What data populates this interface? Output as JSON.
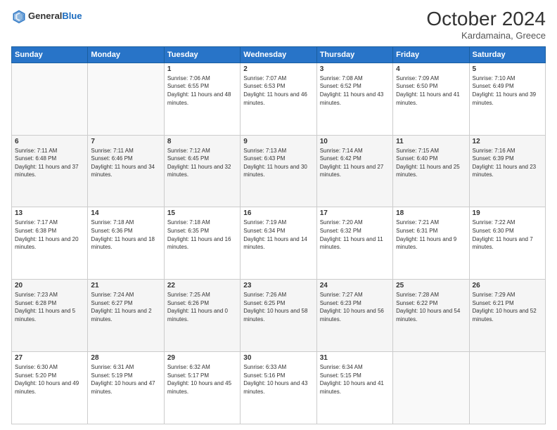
{
  "header": {
    "logo_general": "General",
    "logo_blue": "Blue",
    "month": "October 2024",
    "location": "Kardamaina, Greece"
  },
  "weekdays": [
    "Sunday",
    "Monday",
    "Tuesday",
    "Wednesday",
    "Thursday",
    "Friday",
    "Saturday"
  ],
  "weeks": [
    [
      {
        "day": "",
        "sunrise": "",
        "sunset": "",
        "daylight": ""
      },
      {
        "day": "",
        "sunrise": "",
        "sunset": "",
        "daylight": ""
      },
      {
        "day": "1",
        "sunrise": "Sunrise: 7:06 AM",
        "sunset": "Sunset: 6:55 PM",
        "daylight": "Daylight: 11 hours and 48 minutes."
      },
      {
        "day": "2",
        "sunrise": "Sunrise: 7:07 AM",
        "sunset": "Sunset: 6:53 PM",
        "daylight": "Daylight: 11 hours and 46 minutes."
      },
      {
        "day": "3",
        "sunrise": "Sunrise: 7:08 AM",
        "sunset": "Sunset: 6:52 PM",
        "daylight": "Daylight: 11 hours and 43 minutes."
      },
      {
        "day": "4",
        "sunrise": "Sunrise: 7:09 AM",
        "sunset": "Sunset: 6:50 PM",
        "daylight": "Daylight: 11 hours and 41 minutes."
      },
      {
        "day": "5",
        "sunrise": "Sunrise: 7:10 AM",
        "sunset": "Sunset: 6:49 PM",
        "daylight": "Daylight: 11 hours and 39 minutes."
      }
    ],
    [
      {
        "day": "6",
        "sunrise": "Sunrise: 7:11 AM",
        "sunset": "Sunset: 6:48 PM",
        "daylight": "Daylight: 11 hours and 37 minutes."
      },
      {
        "day": "7",
        "sunrise": "Sunrise: 7:11 AM",
        "sunset": "Sunset: 6:46 PM",
        "daylight": "Daylight: 11 hours and 34 minutes."
      },
      {
        "day": "8",
        "sunrise": "Sunrise: 7:12 AM",
        "sunset": "Sunset: 6:45 PM",
        "daylight": "Daylight: 11 hours and 32 minutes."
      },
      {
        "day": "9",
        "sunrise": "Sunrise: 7:13 AM",
        "sunset": "Sunset: 6:43 PM",
        "daylight": "Daylight: 11 hours and 30 minutes."
      },
      {
        "day": "10",
        "sunrise": "Sunrise: 7:14 AM",
        "sunset": "Sunset: 6:42 PM",
        "daylight": "Daylight: 11 hours and 27 minutes."
      },
      {
        "day": "11",
        "sunrise": "Sunrise: 7:15 AM",
        "sunset": "Sunset: 6:40 PM",
        "daylight": "Daylight: 11 hours and 25 minutes."
      },
      {
        "day": "12",
        "sunrise": "Sunrise: 7:16 AM",
        "sunset": "Sunset: 6:39 PM",
        "daylight": "Daylight: 11 hours and 23 minutes."
      }
    ],
    [
      {
        "day": "13",
        "sunrise": "Sunrise: 7:17 AM",
        "sunset": "Sunset: 6:38 PM",
        "daylight": "Daylight: 11 hours and 20 minutes."
      },
      {
        "day": "14",
        "sunrise": "Sunrise: 7:18 AM",
        "sunset": "Sunset: 6:36 PM",
        "daylight": "Daylight: 11 hours and 18 minutes."
      },
      {
        "day": "15",
        "sunrise": "Sunrise: 7:18 AM",
        "sunset": "Sunset: 6:35 PM",
        "daylight": "Daylight: 11 hours and 16 minutes."
      },
      {
        "day": "16",
        "sunrise": "Sunrise: 7:19 AM",
        "sunset": "Sunset: 6:34 PM",
        "daylight": "Daylight: 11 hours and 14 minutes."
      },
      {
        "day": "17",
        "sunrise": "Sunrise: 7:20 AM",
        "sunset": "Sunset: 6:32 PM",
        "daylight": "Daylight: 11 hours and 11 minutes."
      },
      {
        "day": "18",
        "sunrise": "Sunrise: 7:21 AM",
        "sunset": "Sunset: 6:31 PM",
        "daylight": "Daylight: 11 hours and 9 minutes."
      },
      {
        "day": "19",
        "sunrise": "Sunrise: 7:22 AM",
        "sunset": "Sunset: 6:30 PM",
        "daylight": "Daylight: 11 hours and 7 minutes."
      }
    ],
    [
      {
        "day": "20",
        "sunrise": "Sunrise: 7:23 AM",
        "sunset": "Sunset: 6:28 PM",
        "daylight": "Daylight: 11 hours and 5 minutes."
      },
      {
        "day": "21",
        "sunrise": "Sunrise: 7:24 AM",
        "sunset": "Sunset: 6:27 PM",
        "daylight": "Daylight: 11 hours and 2 minutes."
      },
      {
        "day": "22",
        "sunrise": "Sunrise: 7:25 AM",
        "sunset": "Sunset: 6:26 PM",
        "daylight": "Daylight: 11 hours and 0 minutes."
      },
      {
        "day": "23",
        "sunrise": "Sunrise: 7:26 AM",
        "sunset": "Sunset: 6:25 PM",
        "daylight": "Daylight: 10 hours and 58 minutes."
      },
      {
        "day": "24",
        "sunrise": "Sunrise: 7:27 AM",
        "sunset": "Sunset: 6:23 PM",
        "daylight": "Daylight: 10 hours and 56 minutes."
      },
      {
        "day": "25",
        "sunrise": "Sunrise: 7:28 AM",
        "sunset": "Sunset: 6:22 PM",
        "daylight": "Daylight: 10 hours and 54 minutes."
      },
      {
        "day": "26",
        "sunrise": "Sunrise: 7:29 AM",
        "sunset": "Sunset: 6:21 PM",
        "daylight": "Daylight: 10 hours and 52 minutes."
      }
    ],
    [
      {
        "day": "27",
        "sunrise": "Sunrise: 6:30 AM",
        "sunset": "Sunset: 5:20 PM",
        "daylight": "Daylight: 10 hours and 49 minutes."
      },
      {
        "day": "28",
        "sunrise": "Sunrise: 6:31 AM",
        "sunset": "Sunset: 5:19 PM",
        "daylight": "Daylight: 10 hours and 47 minutes."
      },
      {
        "day": "29",
        "sunrise": "Sunrise: 6:32 AM",
        "sunset": "Sunset: 5:17 PM",
        "daylight": "Daylight: 10 hours and 45 minutes."
      },
      {
        "day": "30",
        "sunrise": "Sunrise: 6:33 AM",
        "sunset": "Sunset: 5:16 PM",
        "daylight": "Daylight: 10 hours and 43 minutes."
      },
      {
        "day": "31",
        "sunrise": "Sunrise: 6:34 AM",
        "sunset": "Sunset: 5:15 PM",
        "daylight": "Daylight: 10 hours and 41 minutes."
      },
      {
        "day": "",
        "sunrise": "",
        "sunset": "",
        "daylight": ""
      },
      {
        "day": "",
        "sunrise": "",
        "sunset": "",
        "daylight": ""
      }
    ]
  ]
}
